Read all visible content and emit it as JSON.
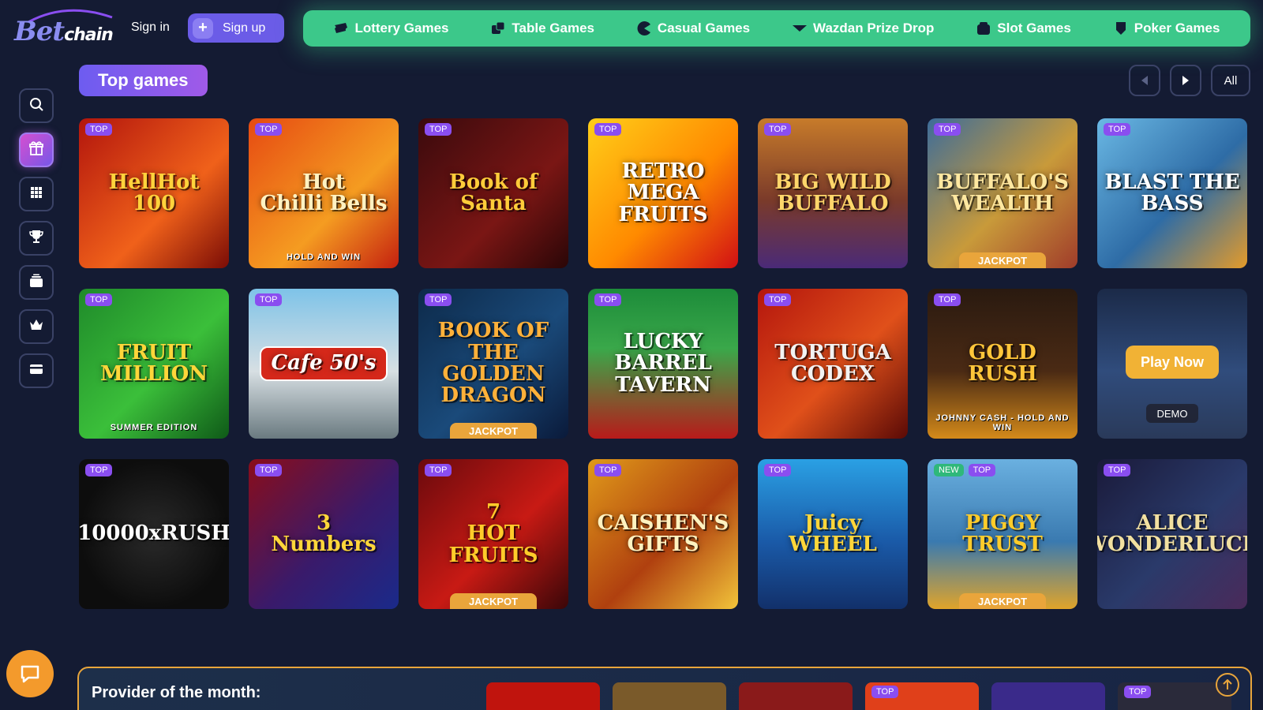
{
  "header": {
    "logo_text_main": "Bet",
    "logo_text_sub": "chain",
    "sign_in": "Sign in",
    "sign_up": "Sign up",
    "categories": [
      {
        "label": "Lottery Games",
        "icon": "lottery-ticket-icon"
      },
      {
        "label": "Table Games",
        "icon": "dice-icon"
      },
      {
        "label": "Casual Games",
        "icon": "pacman-icon"
      },
      {
        "label": "Wazdan Prize Drop",
        "icon": "drop-icon"
      },
      {
        "label": "Slot Games",
        "icon": "slot-machine-icon"
      },
      {
        "label": "Poker Games",
        "icon": "poker-chip-icon"
      }
    ]
  },
  "sidebar": {
    "items": [
      {
        "icon": "search-icon",
        "active": false
      },
      {
        "icon": "gift-icon",
        "active": true
      },
      {
        "icon": "grid-icon",
        "active": false
      },
      {
        "icon": "trophy-icon",
        "active": false
      },
      {
        "icon": "cards-stack-icon",
        "active": false
      },
      {
        "icon": "crown-icon",
        "active": false
      },
      {
        "icon": "wallet-card-icon",
        "active": false
      }
    ]
  },
  "top_games": {
    "title": "Top games",
    "all_label": "All",
    "games": [
      {
        "name": "HellHot\n100",
        "badges": [
          "TOP"
        ],
        "bg": "linear-gradient(135deg,#b2150d,#f0611a 60%,#7a0c06)",
        "color": "#ffd33c"
      },
      {
        "name": "Hot\nChilli Bells",
        "sub": "HOLD AND WIN",
        "badges": [
          "TOP"
        ],
        "bg": "linear-gradient(135deg,#e64a12,#f59c21 60%,#c4200f)",
        "color": "#fff2c2"
      },
      {
        "name": "Book of\nSanta",
        "badges": [
          "TOP"
        ],
        "bg": "linear-gradient(135deg,#3a0a0d,#7a1614 60%,#2a0607)",
        "color": "#ffcc3a"
      },
      {
        "name": "RETRO MEGA\nFRUITS",
        "badges": [
          "TOP"
        ],
        "bg": "linear-gradient(135deg,#ffce19,#ff8a00 55%,#d10f14)",
        "color": "#ffffff"
      },
      {
        "name": "BIG WILD\nBUFFALO",
        "badges": [
          "TOP"
        ],
        "bg": "linear-gradient(180deg,#c77b2a,#7a3a2a 55%,#4a2a78)",
        "color": "#ffd66a"
      },
      {
        "name": "BUFFALO'S\nWEALTH",
        "badges": [
          "TOP"
        ],
        "jackpot": "JACKPOT",
        "bg": "linear-gradient(135deg,#3c6c9a,#c89a3a 55%,#a03c2a)",
        "color": "#ffe8a0"
      },
      {
        "name": "BLAST THE\nBASS",
        "badges": [
          "TOP"
        ],
        "bg": "linear-gradient(135deg,#6ab8e4,#2e6ca6 55%,#e49b2a)",
        "color": "#ffffff"
      },
      {
        "name": "FRUIT\nMILLION",
        "sub": "SUMMER EDITION",
        "badges": [
          "TOP"
        ],
        "bg": "linear-gradient(135deg,#1f8a2a,#3bbf3a 55%,#0f5a18)",
        "color": "#ffd63a"
      },
      {
        "name": "Cafe 50's",
        "badges": [
          "TOP"
        ],
        "bg": "linear-gradient(180deg,#7ec3e8,#d7dfe3 55%,#6a7a80)",
        "color": "#ffffff",
        "pill": true
      },
      {
        "name": "BOOK OF THE\nGOLDEN\nDRAGON",
        "badges": [
          "TOP"
        ],
        "jackpot": "JACKPOT",
        "bg": "linear-gradient(135deg,#0d2a4a,#1a4a7a 55%,#0a1a3a)",
        "color": "#ffb13a"
      },
      {
        "name": "LUCKY\nBARREL\nTAVERN",
        "badges": [
          "TOP"
        ],
        "bg": "linear-gradient(180deg,#1d8c3a,#3aa84a 40%,#b81a1a)",
        "color": "#ffffff"
      },
      {
        "name": "TORTUGA\nCODEX",
        "badges": [
          "TOP"
        ],
        "bg": "linear-gradient(135deg,#b4160d,#e0501a 55%,#5a0a06)",
        "color": "#f2f2f2"
      },
      {
        "name": "GOLD RUSH",
        "sub": "JOHNNY CASH - HOLD AND WIN",
        "badges": [
          "TOP"
        ],
        "bg": "linear-gradient(180deg,#2a1a10,#4a2a14 55%,#d48a1a)",
        "color": "#ffc63a"
      },
      {
        "name": "",
        "badges": [],
        "bg": "linear-gradient(180deg,#1b2a48,#304c7c 55%,#2a3a5a)",
        "color": "#ffffff",
        "play_now": "Play Now",
        "demo": "DEMO"
      },
      {
        "name": "10000xRUSH",
        "badges": [
          "TOP"
        ],
        "bg": "radial-gradient(circle at 50% 50%,#2a2a2a,#0d0d0d 70%)",
        "color": "#ffffff"
      },
      {
        "name": "3\nNumbers",
        "badges": [
          "TOP"
        ],
        "bg": "linear-gradient(135deg,#8a0d1a,#3a1a6a 55%,#1a2a8a)",
        "color": "#ffd63a"
      },
      {
        "name": "7\nHOT\nFRUITS",
        "badges": [
          "TOP"
        ],
        "jackpot": "JACKPOT",
        "bg": "linear-gradient(135deg,#6a0a0d,#c81a14 55%,#3a0608)",
        "color": "#ffcc2a"
      },
      {
        "name": "CAISHEN'S\nGIFTS",
        "badges": [
          "TOP"
        ],
        "bg": "linear-gradient(135deg,#e09a1a,#b0400f 55%,#f2c43a)",
        "color": "#fff2c0"
      },
      {
        "name": "Juicy\nWHEEL",
        "badges": [
          "TOP"
        ],
        "bg": "linear-gradient(180deg,#2aa0e4,#1a5aa8 55%,#12306a)",
        "color": "#ffd63a"
      },
      {
        "name": "PIGGY\nTRUST",
        "badges": [
          "NEW",
          "TOP"
        ],
        "jackpot": "JACKPOT",
        "bg": "linear-gradient(180deg,#6ab0e0,#3a7ab0 55%,#e0a42a)",
        "color": "#ffcc2a"
      },
      {
        "name": "ALICE\nWONDERLUCK",
        "badges": [
          "TOP"
        ],
        "bg": "linear-gradient(135deg,#1a1a3a,#2a3a6a 55%,#4a2a5a)",
        "color": "#f2e0a0"
      }
    ]
  },
  "provider": {
    "title": "Provider of the month:",
    "tiles": [
      {
        "badges": [],
        "bg": "#c0140d"
      },
      {
        "badges": [],
        "bg": "#7a5a2a"
      },
      {
        "badges": [],
        "bg": "#8a1a1a"
      },
      {
        "badges": [
          "TOP"
        ],
        "bg": "#e0401a"
      },
      {
        "badges": [],
        "bg": "#3a2a8a"
      },
      {
        "badges": [
          "TOP"
        ],
        "bg": "#2a2a3a"
      }
    ]
  },
  "colors": {
    "background": "#141b33",
    "category_bar": "#3cc88a",
    "accent_purple": "#6d5cf0",
    "badge_top": "#8a4ef0",
    "badge_new": "#2fb87a",
    "jackpot": "#e9a53b",
    "chat": "#f39a2c"
  }
}
